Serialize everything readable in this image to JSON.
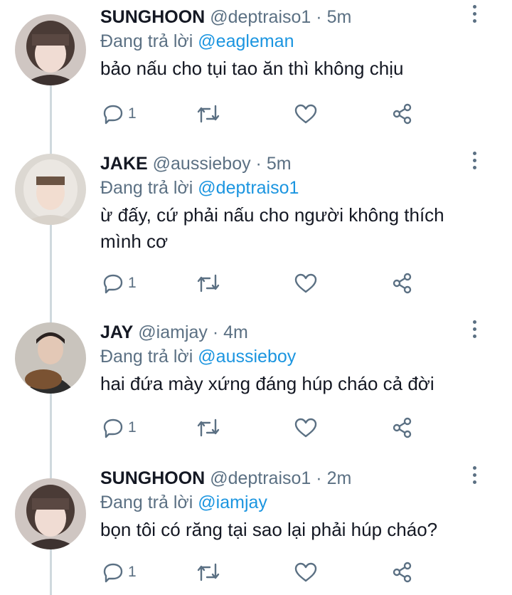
{
  "tweets": [
    {
      "name": "SUNGHOON",
      "handle": "@deptraiso1",
      "sep": "·",
      "time": "5m",
      "reply_prefix": "Đang trả lời",
      "reply_to": "@eagleman",
      "text": "bảo nấu cho tụi tao ăn thì không chịu",
      "reply_count": "1"
    },
    {
      "name": "JAKE",
      "handle": "@aussieboy",
      "sep": "·",
      "time": "5m",
      "reply_prefix": "Đang trả lời",
      "reply_to": "@deptraiso1",
      "text": "ừ đấy, cứ phải nấu cho người không thích mình cơ",
      "reply_count": "1"
    },
    {
      "name": "JAY",
      "handle": "@iamjay",
      "sep": "·",
      "time": "4m",
      "reply_prefix": "Đang trả lời",
      "reply_to": "@aussieboy",
      "text": "hai đứa mày xứng đáng húp cháo cả đời",
      "reply_count": "1"
    },
    {
      "name": "SUNGHOON",
      "handle": "@deptraiso1",
      "sep": "·",
      "time": "2m",
      "reply_prefix": "Đang trả lời",
      "reply_to": "@iamjay",
      "text": "bọn tôi có răng tại sao lại phải húp cháo?",
      "reply_count": "1"
    }
  ],
  "icons": {
    "reply": "comment-icon",
    "retweet": "retweet-icon",
    "like": "heart-icon",
    "share": "share-icon",
    "more": "more-vertical-icon"
  },
  "colors": {
    "text": "#141823",
    "secondary": "#5b7083",
    "mention": "#1b95e0",
    "thread_line": "#cfd9de"
  }
}
